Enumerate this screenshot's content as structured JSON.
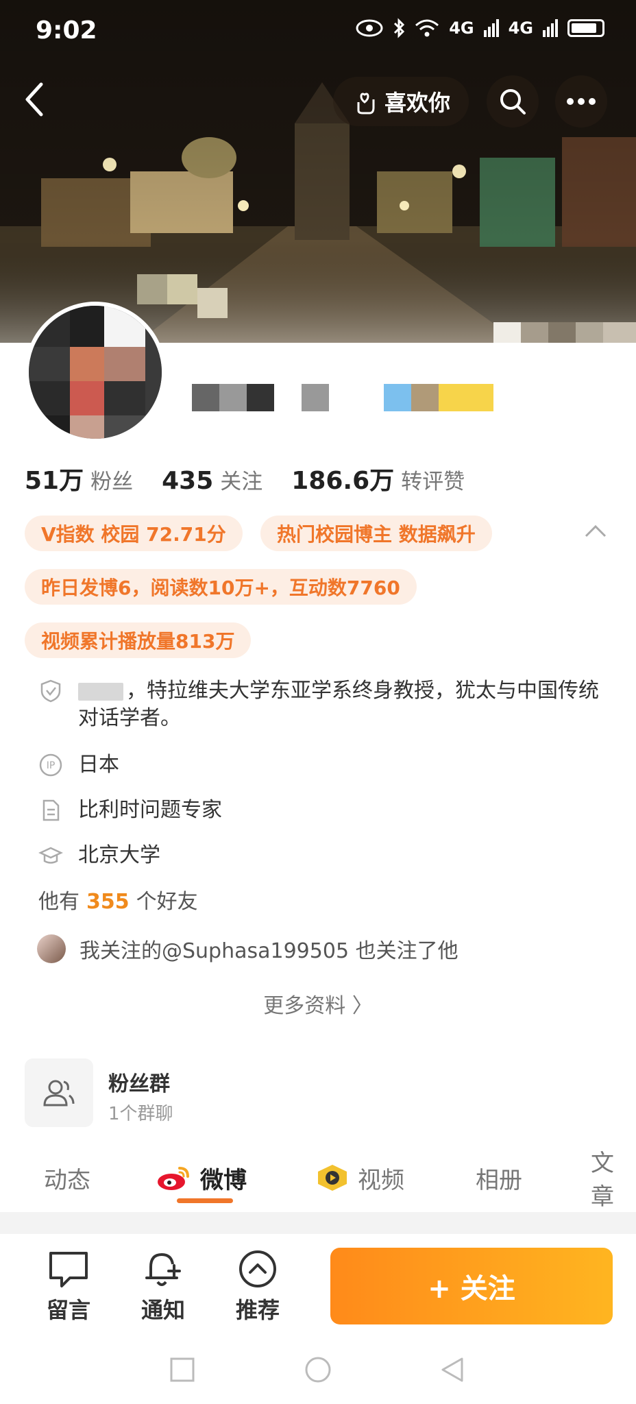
{
  "status_bar": {
    "time": "9:02",
    "network_1": "4G",
    "network_2": "4G"
  },
  "header": {
    "like_label": "喜欢你"
  },
  "stats": [
    {
      "value": "51万",
      "label": "粉丝"
    },
    {
      "value": "435",
      "label": "关注"
    },
    {
      "value": "186.6万",
      "label": "转评赞"
    }
  ],
  "tags": {
    "v_index": "V指数 校园 72.71分",
    "hot_blogger": "热门校园博主 数据飙升",
    "yesterday": "昨日发博6，阅读数10万+，互动数7760",
    "video_plays": "视频累计播放量813万"
  },
  "bio": {
    "text": "，特拉维夫大学东亚学系终身教授，犹太与中国传统对话学者。"
  },
  "info": {
    "ip": "日本",
    "expertise": "比利时问题专家",
    "school": "北京大学"
  },
  "friends": {
    "prefix": "他有",
    "count": "355",
    "suffix": "个好友"
  },
  "mutual": {
    "text": "我关注的@Suphasa199505 也关注了他"
  },
  "more_info": "更多资料 〉",
  "fan_group": {
    "title": "粉丝群",
    "subtitle": "1个群聊"
  },
  "tabs": [
    {
      "label": "动态"
    },
    {
      "label": "微博"
    },
    {
      "label": "视频"
    },
    {
      "label": "相册"
    },
    {
      "label": "文章"
    }
  ],
  "bottom_bar": {
    "message": "留言",
    "notify": "通知",
    "recommend": "推荐",
    "follow": "+ 关注"
  },
  "colors": {
    "accent": "#f0762a",
    "follow_start": "#ff8a1a",
    "follow_end": "#ffb520",
    "tag_bg": "#fdeee4"
  }
}
